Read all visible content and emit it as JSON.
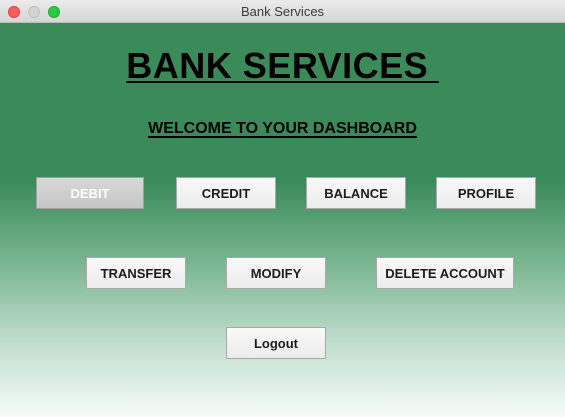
{
  "window": {
    "title": "Bank Services"
  },
  "dashboard": {
    "heading": "BANK SERVICES ",
    "welcome": "WELCOME TO YOUR DASHBOARD"
  },
  "buttons": {
    "debit": "DEBIT",
    "credit": "CREDIT",
    "balance": "BALANCE",
    "profile": "PROFILE",
    "transfer": "TRANSFER",
    "modify": "MODIFY",
    "delete_account": "DELETE ACCOUNT",
    "logout": "Logout"
  },
  "state": {
    "pressed_button": "debit"
  },
  "colors": {
    "background_top": "#3b8a5a",
    "background_bottom": "#f6fbf8",
    "close": "#fd5f57",
    "minimize_inactive": "#d2d2d2",
    "maximize": "#29c940"
  }
}
